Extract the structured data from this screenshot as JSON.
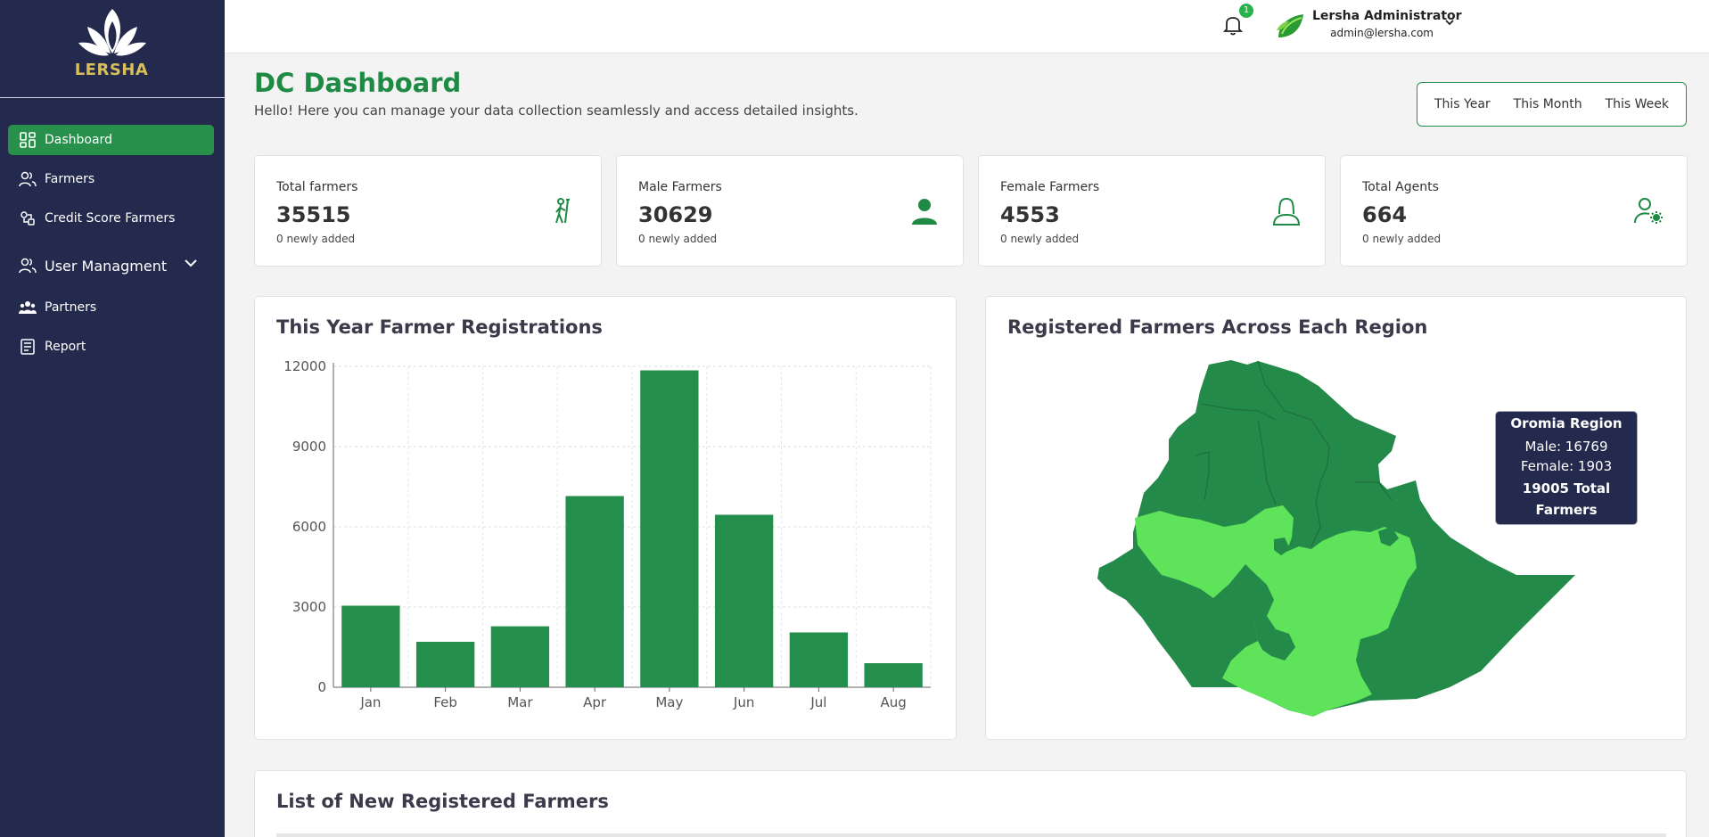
{
  "sidebar": {
    "brand": "LERSHA",
    "items": [
      {
        "label": "Dashboard",
        "active": true
      },
      {
        "label": "Farmers"
      },
      {
        "label": "Credit Score Farmers"
      },
      {
        "label": "User Managment"
      },
      {
        "label": "Partners"
      },
      {
        "label": "Report"
      }
    ]
  },
  "topbar": {
    "notification_count": "1",
    "user_name": "Lersha Administrator",
    "user_email": "admin@lersha.com"
  },
  "header": {
    "title": "DC Dashboard",
    "subtitle": "Hello! Here you can manage your data collection seamlessly and access detailed insights.",
    "ranges": [
      "This Year",
      "This Month",
      "This Week"
    ]
  },
  "stats": [
    {
      "label": "Total farmers",
      "value": "35515",
      "sub": "0 newly added",
      "icon": "farmer-icon"
    },
    {
      "label": "Male Farmers",
      "value": "30629",
      "sub": "0 newly added",
      "icon": "male-user-icon"
    },
    {
      "label": "Female Farmers",
      "value": "4553",
      "sub": "0 newly added",
      "icon": "female-user-icon"
    },
    {
      "label": "Total Agents",
      "value": "664",
      "sub": "0 newly added",
      "icon": "user-settings-icon"
    }
  ],
  "registrations_panel": {
    "title": "This Year Farmer Registrations"
  },
  "regions_panel": {
    "title": "Registered Farmers Across Each Region",
    "tooltip": {
      "title": "Oromia Region",
      "male": "Male: 16769",
      "female": "Female: 1903",
      "total_line1": "19005 Total",
      "total_line2": "Farmers"
    }
  },
  "list_panel": {
    "title": "List of New Registered Farmers"
  },
  "colors": {
    "sidebar": "#232a4d",
    "accent": "#27914b",
    "bar": "#248f4d",
    "map_dark": "#238a4a",
    "map_light": "#5ee35b"
  },
  "chart_data": {
    "type": "bar",
    "categories": [
      "Jan",
      "Feb",
      "Mar",
      "Apr",
      "May",
      "Jun",
      "Jul",
      "Aug"
    ],
    "values": [
      3050,
      1700,
      2280,
      7150,
      11850,
      6450,
      2050,
      900
    ],
    "yticks": [
      0,
      3000,
      6000,
      9000,
      12000
    ],
    "ylim": [
      0,
      12000
    ],
    "grid": true,
    "title": "This Year Farmer Registrations",
    "xlabel": "",
    "ylabel": ""
  }
}
